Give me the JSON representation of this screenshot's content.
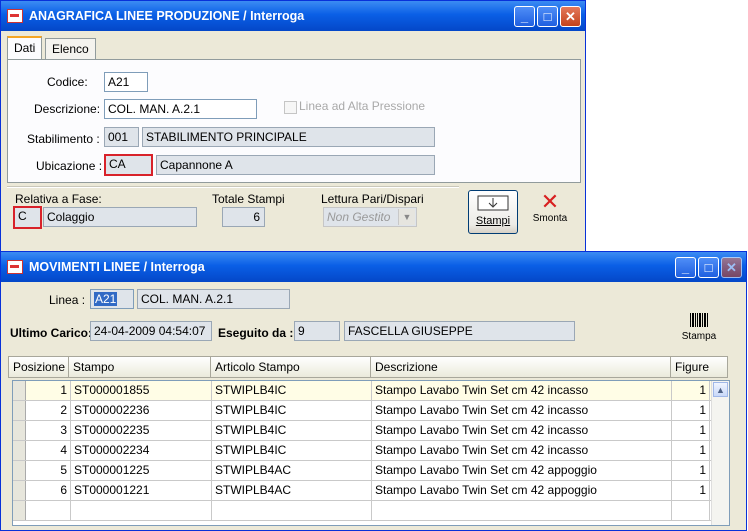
{
  "win1": {
    "title": "ANAGRAFICA LINEE PRODUZIONE / Interroga",
    "tabs": [
      "Dati",
      "Elenco"
    ],
    "codice_label": "Codice:",
    "codice_value": "A21",
    "descrizione_label": "Descrizione:",
    "descrizione_value": "COL. MAN. A.2.1",
    "alta_pressione_label": "Linea ad Alta Pressione",
    "stabilimento_label": "Stabilimento :",
    "stabilimento_code": "001",
    "stabilimento_name": "STABILIMENTO PRINCIPALE",
    "ubicazione_label": "Ubicazione :",
    "ubicazione_code": "CA",
    "ubicazione_name": "Capannone A",
    "fase_label": "Relativa a Fase:",
    "fase_code": "C",
    "fase_name": "Colaggio",
    "totale_label": "Totale Stampi",
    "totale_value": "6",
    "lettura_label": "Lettura Pari/Dispari",
    "lettura_value": "Non Gestito",
    "stampi_button": "Stampi",
    "smonta_button": "Smonta"
  },
  "win2": {
    "title": "MOVIMENTI LINEE / Interroga",
    "linea_label": "Linea :",
    "linea_code": "A21",
    "linea_name": "COL. MAN. A.2.1",
    "ultimo_label": "Ultimo Carico:",
    "ultimo_value": "24-04-2009 04:54:07",
    "eseguito_label": "Eseguito da :",
    "eseguito_code": "9",
    "eseguito_name": "FASCELLA GIUSEPPE",
    "stampa_button": "Stampa",
    "columns": [
      "Posizione",
      "Stampo",
      "Articolo Stampo",
      "Descrizione",
      "Figure"
    ],
    "rows": [
      {
        "pos": "1",
        "stampo": "ST000001855",
        "articolo": "STWIPLB4IC",
        "descr": "Stampo Lavabo Twin Set cm 42 incasso",
        "figure": "1"
      },
      {
        "pos": "2",
        "stampo": "ST000002236",
        "articolo": "STWIPLB4IC",
        "descr": "Stampo Lavabo Twin Set cm 42 incasso",
        "figure": "1"
      },
      {
        "pos": "3",
        "stampo": "ST000002235",
        "articolo": "STWIPLB4IC",
        "descr": "Stampo Lavabo Twin Set cm 42 incasso",
        "figure": "1"
      },
      {
        "pos": "4",
        "stampo": "ST000002234",
        "articolo": "STWIPLB4IC",
        "descr": "Stampo Lavabo Twin Set cm 42 incasso",
        "figure": "1"
      },
      {
        "pos": "5",
        "stampo": "ST000001225",
        "articolo": "STWIPLB4AC",
        "descr": "Stampo Lavabo Twin Set cm 42 appoggio",
        "figure": "1"
      },
      {
        "pos": "6",
        "stampo": "ST000001221",
        "articolo": "STWIPLB4AC",
        "descr": "Stampo Lavabo Twin Set cm 42 appoggio",
        "figure": "1"
      }
    ]
  }
}
